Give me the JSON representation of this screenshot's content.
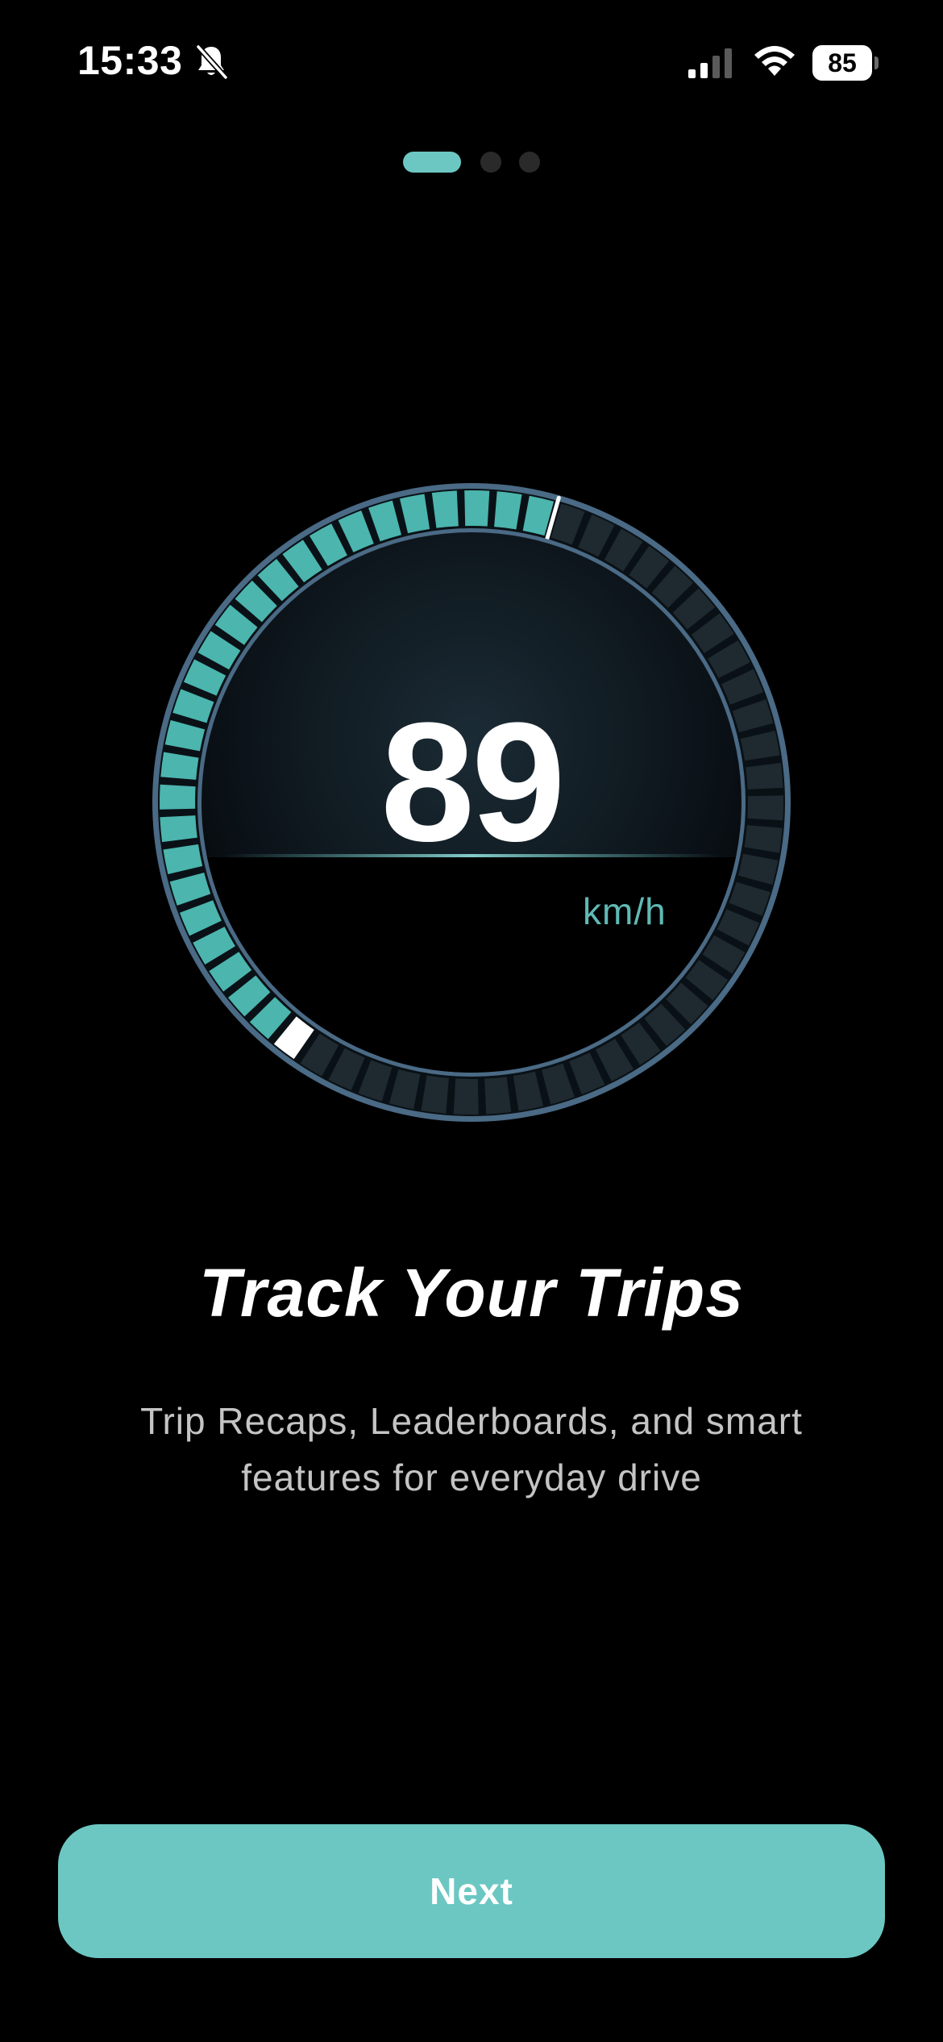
{
  "status_bar": {
    "time": "15:33",
    "battery": "85",
    "icons": [
      "bell-slash-icon",
      "signal-icon",
      "wifi-icon",
      "battery-icon"
    ]
  },
  "pager": {
    "total": 3,
    "active": 0
  },
  "gauge": {
    "speed": "89",
    "unit": "km/h",
    "fill_fraction": 0.45,
    "colors": {
      "active": "#4bb5ae",
      "inactive": "#1e2a30",
      "rim": "#4a6a85",
      "highlight": "#ffffff"
    }
  },
  "content": {
    "title": "Track Your Trips",
    "subtitle": "Trip Recaps, Leaderboards, and smart features for everyday drive"
  },
  "actions": {
    "next_label": "Next"
  },
  "colors": {
    "accent": "#6cc7c2",
    "background": "#000000"
  }
}
